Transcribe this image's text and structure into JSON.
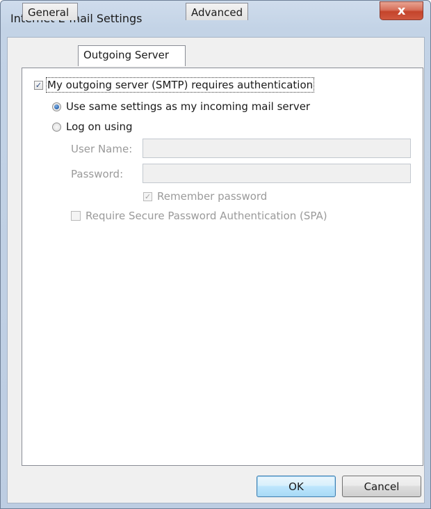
{
  "window": {
    "title": "Internet E-mail Settings",
    "close_glyph": "x"
  },
  "tabs": [
    {
      "label": "General",
      "active": false
    },
    {
      "label": "Outgoing Server",
      "active": true
    },
    {
      "label": "Advanced",
      "active": false
    }
  ],
  "outgoing": {
    "requires_auth": {
      "label": "My outgoing server (SMTP) requires authentication",
      "checked": true
    },
    "use_same": {
      "label": "Use same settings as my incoming mail server",
      "selected": true
    },
    "log_on": {
      "label": "Log on using",
      "selected": false
    },
    "user_name": {
      "label": "User Name:",
      "value": ""
    },
    "password": {
      "label": "Password:",
      "value": ""
    },
    "remember_password": {
      "label": "Remember password",
      "checked": true,
      "enabled": false
    },
    "require_spa": {
      "label": "Require Secure Password Authentication (SPA)",
      "checked": false,
      "enabled": false
    }
  },
  "buttons": {
    "ok": "OK",
    "cancel": "Cancel"
  },
  "icons": {
    "close": "close-icon",
    "check": "checkmark-icon"
  }
}
